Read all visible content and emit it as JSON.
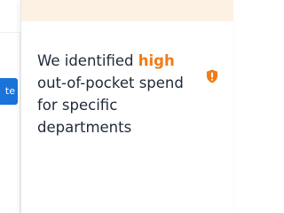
{
  "left_button": {
    "label": "te"
  },
  "insight_card": {
    "text_before": "We identified ",
    "highlight": "high",
    "text_after": " out-of-pocket spend for specific departments",
    "icon": "shield-alert-icon",
    "colors": {
      "highlight": "#f07b17",
      "icon": "#f07b17",
      "band": "#fdf1e4",
      "button": "#1a73d9"
    }
  }
}
